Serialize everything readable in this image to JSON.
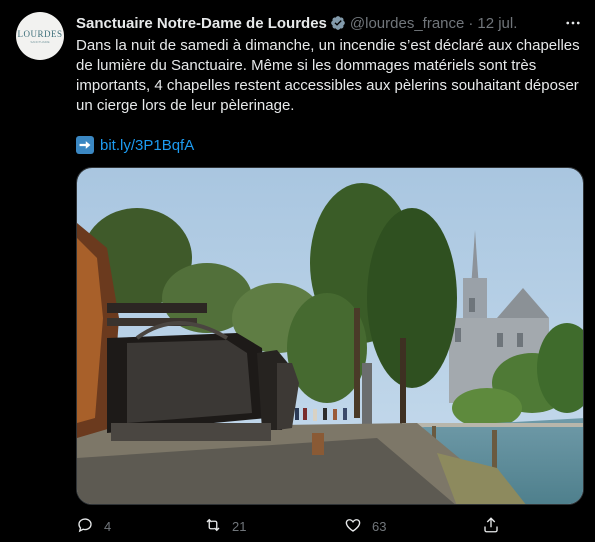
{
  "tweet": {
    "avatar": {
      "word": "LOURDES",
      "sub": "SANCTUAIRE"
    },
    "author_name": "Sanctuaire Notre-Dame de Lourdes",
    "handle": "@lourdes_france",
    "separator": "·",
    "date": "12 jul.",
    "text_lines": [
      "Dans la nuit de samedi à dimanche, un incendie s’est déclaré aux chapelles",
      "de lumière du Sanctuaire. Même si les dommages matériels sont très",
      "importants, 4 chapelles restent accessibles aux pèlerins souhaitant déposer",
      "un cierge lors de leur pèlerinage."
    ],
    "link_text": "bit.ly/3P1BqfA",
    "actions": {
      "reply_count": "4",
      "retweet_count": "21",
      "like_count": "63"
    }
  },
  "colors": {
    "background": "#000000",
    "text": "#e7e9ea",
    "muted": "#71767b",
    "link": "#1d9bf0",
    "verified": "#829aab"
  },
  "icons": {
    "verified": "verified-badge-icon",
    "more": "more-options-icon",
    "link_emoji": "right-arrow-emoji-icon",
    "reply": "reply-icon",
    "retweet": "retweet-icon",
    "like": "heart-icon",
    "share": "share-icon"
  }
}
